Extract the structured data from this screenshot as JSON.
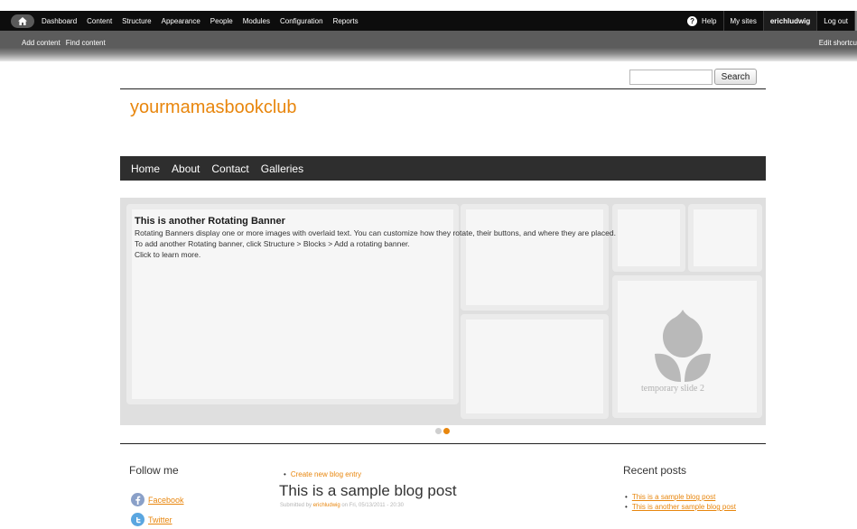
{
  "admin_toolbar": {
    "menu": [
      "Dashboard",
      "Content",
      "Structure",
      "Appearance",
      "People",
      "Modules",
      "Configuration",
      "Reports"
    ],
    "help": "Help",
    "my_sites": "My sites",
    "user": "erichludwig",
    "logout": "Log out"
  },
  "shortcuts": {
    "items": [
      "Add content",
      "Find content"
    ],
    "edit": "Edit shortcu"
  },
  "search": {
    "value": "",
    "button": "Search"
  },
  "site": {
    "name": "yourmamasbookclub"
  },
  "main_nav": [
    "Home",
    "About",
    "Contact",
    "Galleries"
  ],
  "banner": {
    "title": "This is another Rotating Banner",
    "lines": [
      "Rotating Banners display one or more images with overlaid text. You can customize how they rotate, their buttons, and where they are placed.",
      "To add another Rotating banner, click Structure > Blocks > Add a rotating banner.",
      "Click to learn more."
    ],
    "slide_label": "temporary slide 2",
    "pager_active": 2,
    "pager_count": 2
  },
  "follow": {
    "title": "Follow me",
    "links": [
      "Facebook",
      "Twitter"
    ]
  },
  "content": {
    "create_link": "Create new blog entry",
    "post_title": "This is a sample blog post",
    "submitted_prefix": "Submitted by",
    "author": "erichludwig",
    "submitted_suffix": "on Fri, 05/13/2011 - 20:30"
  },
  "recent": {
    "title": "Recent posts",
    "items": [
      "This is a sample blog post",
      "This is another sample blog post"
    ]
  },
  "colors": {
    "accent": "#e8860d",
    "nav_bg": "#2e2e2e",
    "toolbar_bg": "#0d0d0d"
  }
}
